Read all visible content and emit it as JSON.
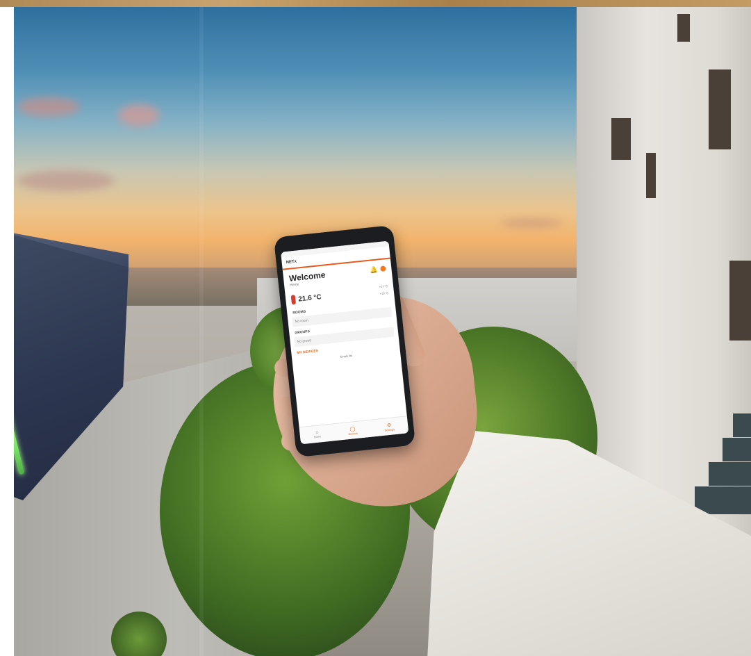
{
  "app": {
    "bar_title": "NETx",
    "welcome_title": "Welcome",
    "welcome_subtitle": "Home",
    "temperature": "21.6 °C",
    "temp_max": "+27 °C",
    "temp_min": "+19 °C",
    "rooms_heading": "ROOMS",
    "rooms_empty": "No room",
    "groups_heading": "GROUPS",
    "groups_empty": "No group",
    "devices_heading": "MY DEVICES",
    "devices_empty": "Empty list",
    "nav": [
      {
        "label": "Home",
        "icon": "home-icon"
      },
      {
        "label": "Scenes",
        "icon": "scenes-icon"
      },
      {
        "label": "Settings",
        "icon": "settings-icon"
      }
    ],
    "accent_color": "#e86a1f"
  },
  "scene": {
    "router_led_color": "#7be06a"
  }
}
